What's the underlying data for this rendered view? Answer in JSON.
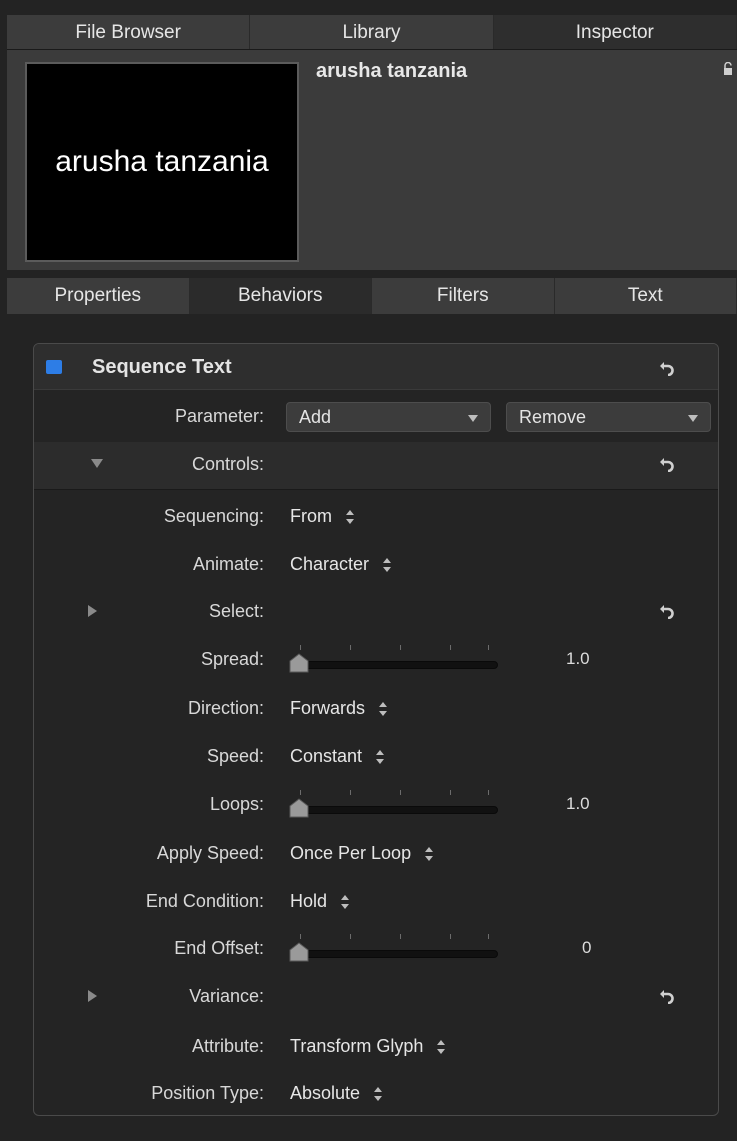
{
  "top_tabs": [
    {
      "label": "File Browser"
    },
    {
      "label": "Library"
    },
    {
      "label": "Inspector"
    }
  ],
  "preview": {
    "thumbnail_text": "arusha tanzania",
    "object_name": "arusha tanzania"
  },
  "sub_tabs": [
    {
      "label": "Properties"
    },
    {
      "label": "Behaviors"
    },
    {
      "label": "Filters"
    },
    {
      "label": "Text"
    }
  ],
  "behavior": {
    "title": "Sequence Text",
    "enabled_color": "#2d7de6",
    "parameter": {
      "label": "Parameter:",
      "add": "Add",
      "remove": "Remove"
    },
    "controls": {
      "label": "Controls:"
    },
    "sequencing": {
      "label": "Sequencing:",
      "value": "From"
    },
    "animate": {
      "label": "Animate:",
      "value": "Character"
    },
    "select": {
      "label": "Select:"
    },
    "spread": {
      "label": "Spread:",
      "value": "1.0",
      "level": 0
    },
    "direction": {
      "label": "Direction:",
      "value": "Forwards"
    },
    "speed": {
      "label": "Speed:",
      "value": "Constant"
    },
    "loops": {
      "label": "Loops:",
      "value": "1.0",
      "level": 0
    },
    "apply_speed": {
      "label": "Apply Speed:",
      "value": "Once Per Loop"
    },
    "end_condition": {
      "label": "End Condition:",
      "value": "Hold"
    },
    "end_offset": {
      "label": "End Offset:",
      "value": "0",
      "level": 0
    },
    "variance": {
      "label": "Variance:"
    },
    "attribute": {
      "label": "Attribute:",
      "value": "Transform Glyph"
    },
    "position_type": {
      "label": "Position Type:",
      "value": "Absolute"
    }
  },
  "icons": {
    "reset": "reset-arrow-icon",
    "lock": "lock-icon",
    "stepper": "up-down-stepper-icon",
    "disclosure": "disclosure-triangle-icon"
  }
}
